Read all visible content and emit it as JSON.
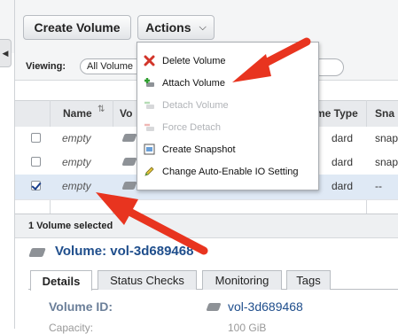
{
  "toolbar": {
    "create_volume_label": "Create Volume",
    "actions_label": "Actions",
    "actions_caret": "⌄"
  },
  "filter": {
    "viewing_label": "Viewing:",
    "viewing_value": "All Volume"
  },
  "table": {
    "headers": {
      "name": "Name",
      "volume": "Vo",
      "type": "me Type",
      "snapshot": "Sna"
    },
    "rows": [
      {
        "name": "empty",
        "type": "dard",
        "snapshot": "snap",
        "checked": false
      },
      {
        "name": "empty",
        "type": "dard",
        "snapshot": "snap",
        "checked": false
      },
      {
        "name": "empty",
        "type": "dard",
        "snapshot": "--",
        "checked": true
      }
    ]
  },
  "actions_menu": {
    "items": [
      {
        "label": "Delete Volume",
        "icon": "delete-x-icon",
        "enabled": true
      },
      {
        "label": "Attach Volume",
        "icon": "attach-plus-icon",
        "enabled": true
      },
      {
        "label": "Detach Volume",
        "icon": "detach-icon",
        "enabled": false
      },
      {
        "label": "Force Detach",
        "icon": "force-detach-icon",
        "enabled": false
      },
      {
        "label": "Create Snapshot",
        "icon": "snapshot-icon",
        "enabled": true
      },
      {
        "label": "Change Auto-Enable IO Setting",
        "icon": "pencil-icon",
        "enabled": true
      }
    ]
  },
  "selection": {
    "summary": "1 Volume selected"
  },
  "detail": {
    "title": "Volume: vol-3d689468",
    "tabs": [
      "Details",
      "Status Checks",
      "Monitoring",
      "Tags"
    ],
    "volume_id_label": "Volume ID:",
    "volume_id_value": "vol-3d689468",
    "capacity_label": "Capacity:",
    "capacity_value": "100 GiB"
  },
  "colors": {
    "accent_blue": "#1f4e8c",
    "arrow_red": "#e8341f"
  }
}
